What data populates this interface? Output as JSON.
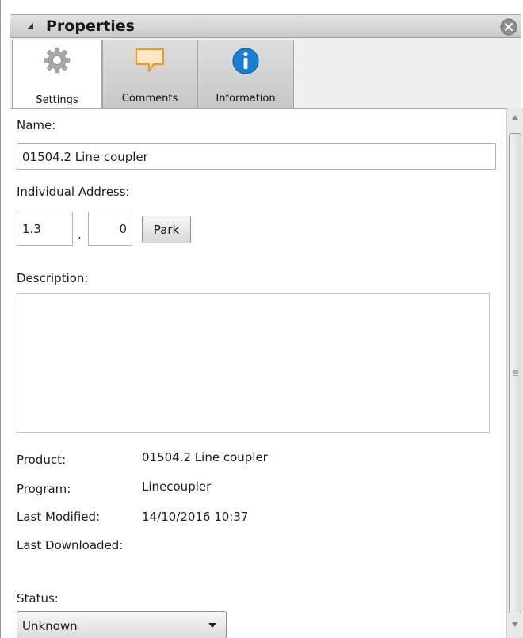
{
  "panel": {
    "title": "Properties",
    "collapse_icon": "collapse-triangle-icon",
    "close_icon": "close-circle-icon"
  },
  "tabs": [
    {
      "label": "Settings",
      "icon": "gear-icon",
      "active": true
    },
    {
      "label": "Comments",
      "icon": "comment-icon",
      "active": false
    },
    {
      "label": "Information",
      "icon": "info-icon",
      "active": false
    }
  ],
  "form": {
    "name_label": "Name:",
    "name_value": "01504.2 Line coupler",
    "address_label": "Individual Address:",
    "address_area": "1.3",
    "address_separator": ".",
    "address_device": "0",
    "park_label": "Park",
    "description_label": "Description:",
    "description_value": ""
  },
  "details": {
    "product_label": "Product:",
    "product_value": "01504.2 Line coupler",
    "program_label": "Program:",
    "program_value": "Linecoupler",
    "modified_label": "Last Modified:",
    "modified_value": "14/10/2016 10:37",
    "downloaded_label": "Last Downloaded:",
    "downloaded_value": ""
  },
  "status": {
    "label": "Status:",
    "value": "Unknown"
  },
  "colors": {
    "info_blue": "#1a7fd4",
    "comment_orange": "#f0a23a",
    "gear_gray": "#a8a8a8"
  }
}
